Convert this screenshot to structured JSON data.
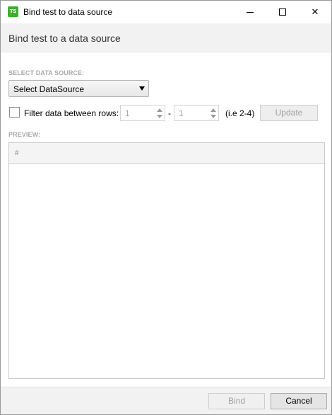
{
  "window": {
    "title": "Bind test to data source",
    "app_icon_text": "TS",
    "app_icon_color": "#3fae29",
    "controls": {
      "minimize": "minimize-icon",
      "maximize": "maximize-icon",
      "close": "✕"
    }
  },
  "header": {
    "title": "Bind test to a data source"
  },
  "datasource": {
    "section_label": "SELECT DATA SOURCE:",
    "selected": "Select DataSource"
  },
  "filter": {
    "label": "Filter data between rows:",
    "from": "1",
    "separator": "-",
    "to": "1",
    "hint": "(i.e 2-4)",
    "checked": false,
    "update_label": "Update"
  },
  "preview": {
    "section_label": "PREVIEW:",
    "columns": [
      "#"
    ],
    "rows": []
  },
  "footer": {
    "bind_label": "Bind",
    "cancel_label": "Cancel"
  }
}
